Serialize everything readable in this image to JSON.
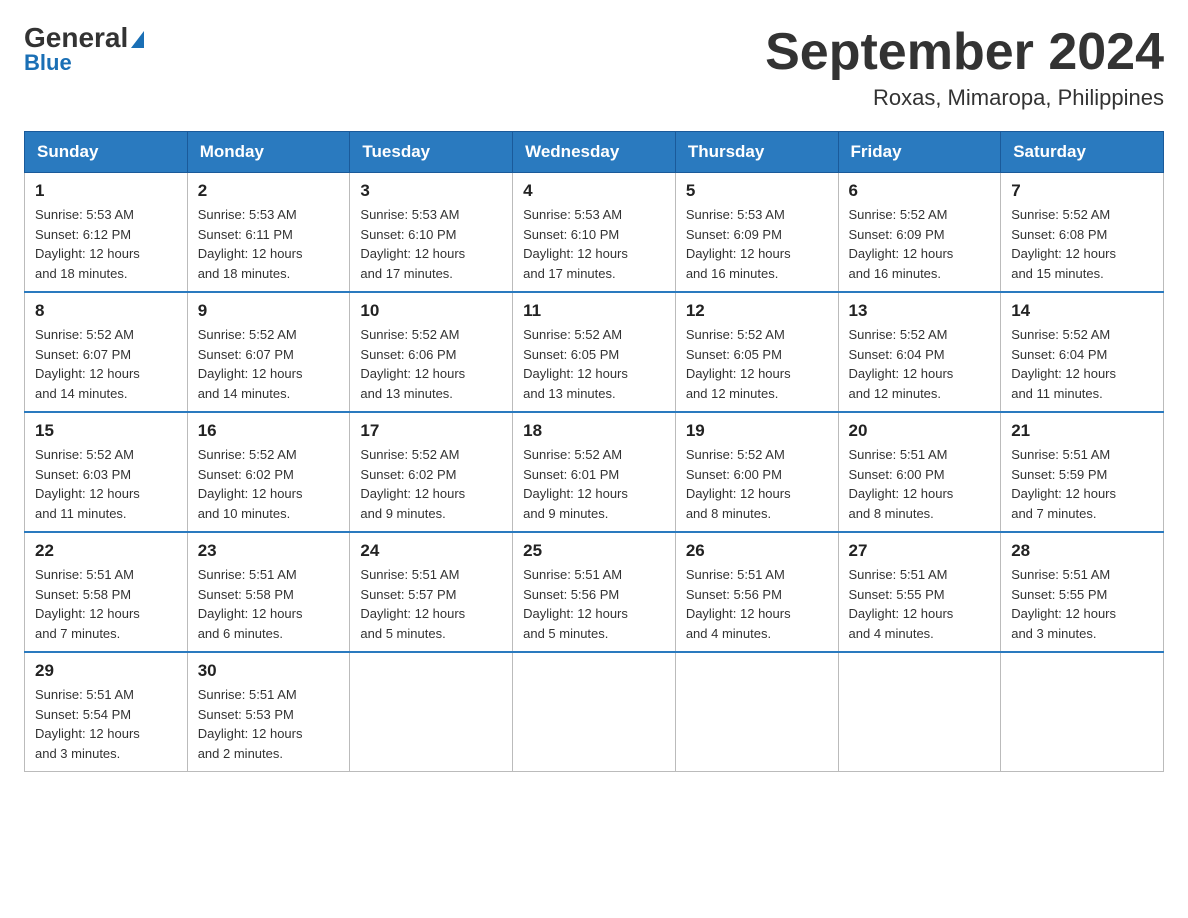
{
  "logo": {
    "general": "General",
    "blue": "Blue"
  },
  "title": "September 2024",
  "subtitle": "Roxas, Mimaropa, Philippines",
  "days_of_week": [
    "Sunday",
    "Monday",
    "Tuesday",
    "Wednesday",
    "Thursday",
    "Friday",
    "Saturday"
  ],
  "weeks": [
    [
      {
        "day": "1",
        "sunrise": "5:53 AM",
        "sunset": "6:12 PM",
        "daylight": "12 hours and 18 minutes."
      },
      {
        "day": "2",
        "sunrise": "5:53 AM",
        "sunset": "6:11 PM",
        "daylight": "12 hours and 18 minutes."
      },
      {
        "day": "3",
        "sunrise": "5:53 AM",
        "sunset": "6:10 PM",
        "daylight": "12 hours and 17 minutes."
      },
      {
        "day": "4",
        "sunrise": "5:53 AM",
        "sunset": "6:10 PM",
        "daylight": "12 hours and 17 minutes."
      },
      {
        "day": "5",
        "sunrise": "5:53 AM",
        "sunset": "6:09 PM",
        "daylight": "12 hours and 16 minutes."
      },
      {
        "day": "6",
        "sunrise": "5:52 AM",
        "sunset": "6:09 PM",
        "daylight": "12 hours and 16 minutes."
      },
      {
        "day": "7",
        "sunrise": "5:52 AM",
        "sunset": "6:08 PM",
        "daylight": "12 hours and 15 minutes."
      }
    ],
    [
      {
        "day": "8",
        "sunrise": "5:52 AM",
        "sunset": "6:07 PM",
        "daylight": "12 hours and 14 minutes."
      },
      {
        "day": "9",
        "sunrise": "5:52 AM",
        "sunset": "6:07 PM",
        "daylight": "12 hours and 14 minutes."
      },
      {
        "day": "10",
        "sunrise": "5:52 AM",
        "sunset": "6:06 PM",
        "daylight": "12 hours and 13 minutes."
      },
      {
        "day": "11",
        "sunrise": "5:52 AM",
        "sunset": "6:05 PM",
        "daylight": "12 hours and 13 minutes."
      },
      {
        "day": "12",
        "sunrise": "5:52 AM",
        "sunset": "6:05 PM",
        "daylight": "12 hours and 12 minutes."
      },
      {
        "day": "13",
        "sunrise": "5:52 AM",
        "sunset": "6:04 PM",
        "daylight": "12 hours and 12 minutes."
      },
      {
        "day": "14",
        "sunrise": "5:52 AM",
        "sunset": "6:04 PM",
        "daylight": "12 hours and 11 minutes."
      }
    ],
    [
      {
        "day": "15",
        "sunrise": "5:52 AM",
        "sunset": "6:03 PM",
        "daylight": "12 hours and 11 minutes."
      },
      {
        "day": "16",
        "sunrise": "5:52 AM",
        "sunset": "6:02 PM",
        "daylight": "12 hours and 10 minutes."
      },
      {
        "day": "17",
        "sunrise": "5:52 AM",
        "sunset": "6:02 PM",
        "daylight": "12 hours and 9 minutes."
      },
      {
        "day": "18",
        "sunrise": "5:52 AM",
        "sunset": "6:01 PM",
        "daylight": "12 hours and 9 minutes."
      },
      {
        "day": "19",
        "sunrise": "5:52 AM",
        "sunset": "6:00 PM",
        "daylight": "12 hours and 8 minutes."
      },
      {
        "day": "20",
        "sunrise": "5:51 AM",
        "sunset": "6:00 PM",
        "daylight": "12 hours and 8 minutes."
      },
      {
        "day": "21",
        "sunrise": "5:51 AM",
        "sunset": "5:59 PM",
        "daylight": "12 hours and 7 minutes."
      }
    ],
    [
      {
        "day": "22",
        "sunrise": "5:51 AM",
        "sunset": "5:58 PM",
        "daylight": "12 hours and 7 minutes."
      },
      {
        "day": "23",
        "sunrise": "5:51 AM",
        "sunset": "5:58 PM",
        "daylight": "12 hours and 6 minutes."
      },
      {
        "day": "24",
        "sunrise": "5:51 AM",
        "sunset": "5:57 PM",
        "daylight": "12 hours and 5 minutes."
      },
      {
        "day": "25",
        "sunrise": "5:51 AM",
        "sunset": "5:56 PM",
        "daylight": "12 hours and 5 minutes."
      },
      {
        "day": "26",
        "sunrise": "5:51 AM",
        "sunset": "5:56 PM",
        "daylight": "12 hours and 4 minutes."
      },
      {
        "day": "27",
        "sunrise": "5:51 AM",
        "sunset": "5:55 PM",
        "daylight": "12 hours and 4 minutes."
      },
      {
        "day": "28",
        "sunrise": "5:51 AM",
        "sunset": "5:55 PM",
        "daylight": "12 hours and 3 minutes."
      }
    ],
    [
      {
        "day": "29",
        "sunrise": "5:51 AM",
        "sunset": "5:54 PM",
        "daylight": "12 hours and 3 minutes."
      },
      {
        "day": "30",
        "sunrise": "5:51 AM",
        "sunset": "5:53 PM",
        "daylight": "12 hours and 2 minutes."
      },
      null,
      null,
      null,
      null,
      null
    ]
  ],
  "labels": {
    "sunrise": "Sunrise:",
    "sunset": "Sunset:",
    "daylight": "Daylight:"
  }
}
